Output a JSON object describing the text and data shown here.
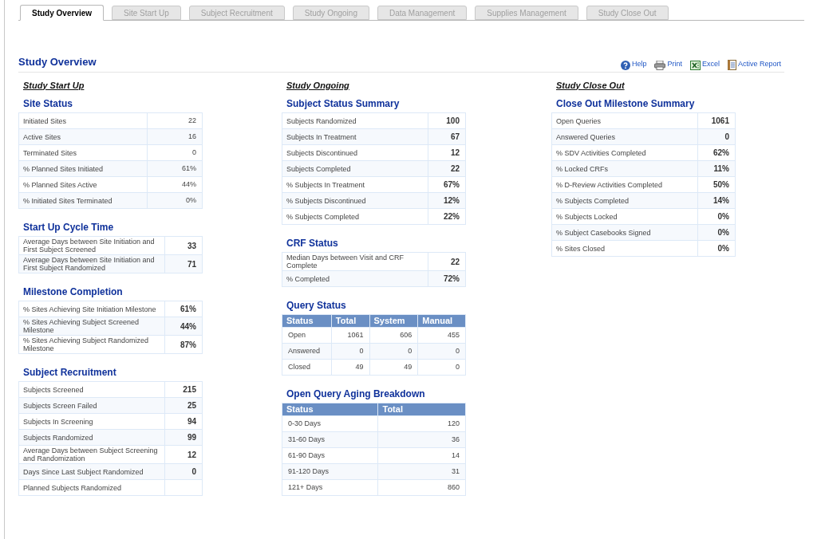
{
  "tabs": [
    {
      "label": "Study Overview",
      "selected": true
    },
    {
      "label": "Site Start Up",
      "selected": false
    },
    {
      "label": "Subject Recruitment",
      "selected": false
    },
    {
      "label": "Study Ongoing",
      "selected": false
    },
    {
      "label": "Data Management",
      "selected": false
    },
    {
      "label": "Supplies Management",
      "selected": false
    },
    {
      "label": "Study Close Out",
      "selected": false
    }
  ],
  "page_title": "Study Overview",
  "toolbar": [
    {
      "kind": "help",
      "label": "Help"
    },
    {
      "kind": "print",
      "label": "Print"
    },
    {
      "kind": "excel",
      "label": "Excel"
    },
    {
      "kind": "report",
      "label": "Active Report"
    }
  ],
  "columns": [
    {
      "heading": "Study Start Up",
      "sections": [
        {
          "title": "Site Status",
          "kind": "kv",
          "bold_values": false,
          "rows": [
            {
              "label": "Initiated Sites",
              "value": "22"
            },
            {
              "label": "Active Sites",
              "value": "16"
            },
            {
              "label": "Terminated Sites",
              "value": "0"
            },
            {
              "label": "% Planned Sites Initiated",
              "value": "61%"
            },
            {
              "label": "% Planned Sites Active",
              "value": "44%"
            },
            {
              "label": "% Initiated Sites Terminated",
              "value": "0%"
            }
          ]
        },
        {
          "title": "Start Up Cycle Time",
          "kind": "kv",
          "bold_values": true,
          "rows": [
            {
              "label": "Average Days between Site Initiation and First Subject Screened",
              "value": "33"
            },
            {
              "label": "Average Days between Site Initiation and First Subject Randomized",
              "value": "71"
            }
          ]
        },
        {
          "title": "Milestone Completion",
          "kind": "kv",
          "bold_values": true,
          "rows": [
            {
              "label": "% Sites Achieving Site Initiation Milestone",
              "value": "61%"
            },
            {
              "label": "% Sites Achieving Subject Screened Milestone",
              "value": "44%"
            },
            {
              "label": "% Sites Achieving Subject Randomized Milestone",
              "value": "87%"
            }
          ]
        },
        {
          "title": "Subject Recruitment",
          "kind": "kv",
          "bold_values": true,
          "rows": [
            {
              "label": "Subjects Screened",
              "value": "215"
            },
            {
              "label": "Subjects Screen Failed",
              "value": "25"
            },
            {
              "label": "Subjects In Screening",
              "value": "94"
            },
            {
              "label": "Subjects Randomized",
              "value": "99"
            },
            {
              "label": "Average Days between Subject Screening and Randomization",
              "value": "12"
            },
            {
              "label": "Days Since Last Subject Randomized",
              "value": "0"
            },
            {
              "label": "Planned Subjects Randomized"
            }
          ]
        }
      ]
    },
    {
      "heading": "Study Ongoing",
      "sections": [
        {
          "title": "Subject Status Summary",
          "kind": "kv",
          "bold_values": true,
          "rows": [
            {
              "label": "Subjects Randomized",
              "value": "100"
            },
            {
              "label": "Subjects In Treatment",
              "value": "67"
            },
            {
              "label": "Subjects Discontinued",
              "value": "12"
            },
            {
              "label": "Subjects Completed",
              "value": "22"
            },
            {
              "label": "% Subjects In Treatment",
              "value": "67%"
            },
            {
              "label": "% Subjects Discontinued",
              "value": "12%"
            },
            {
              "label": "% Subjects Completed",
              "value": "22%"
            }
          ]
        },
        {
          "title": "CRF Status",
          "kind": "kv",
          "bold_values": true,
          "rows": [
            {
              "label": "Median Days between Visit and CRF Complete",
              "value": "22"
            },
            {
              "label": "% Completed",
              "value": "72%"
            }
          ]
        },
        {
          "title": "Query Status",
          "kind": "grid",
          "columns": [
            "Status",
            "Total",
            "System",
            "Manual"
          ],
          "rows": [
            [
              "Open",
              "1061",
              "606",
              "455"
            ],
            [
              "Answered",
              "0",
              "0",
              "0"
            ],
            [
              "Closed",
              "49",
              "49",
              "0"
            ]
          ]
        },
        {
          "title": "Open Query Aging Breakdown",
          "kind": "grid",
          "columns": [
            "Status",
            "Total"
          ],
          "rows": [
            [
              "0-30 Days",
              "120"
            ],
            [
              "31-60 Days",
              "36"
            ],
            [
              "61-90 Days",
              "14"
            ],
            [
              "91-120 Days",
              "31"
            ],
            [
              "121+ Days",
              "860"
            ]
          ]
        }
      ]
    },
    {
      "heading": "Study Close Out",
      "sections": [
        {
          "title": "Close Out Milestone Summary",
          "kind": "kv",
          "bold_values": true,
          "rows": [
            {
              "label": "Open Queries",
              "value": "1061"
            },
            {
              "label": "Answered Queries",
              "value": "0"
            },
            {
              "label": "% SDV Activities Completed",
              "value": "62%"
            },
            {
              "label": "% Locked CRFs",
              "value": "11%"
            },
            {
              "label": "% D-Review Activities Completed",
              "value": "50%"
            },
            {
              "label": "% Subjects Completed",
              "value": "14%"
            },
            {
              "label": "% Subjects Locked",
              "value": "0%"
            },
            {
              "label": "% Subject Casebooks Signed",
              "value": "0%"
            },
            {
              "label": "% Sites Closed",
              "value": "0%"
            }
          ]
        }
      ]
    }
  ]
}
